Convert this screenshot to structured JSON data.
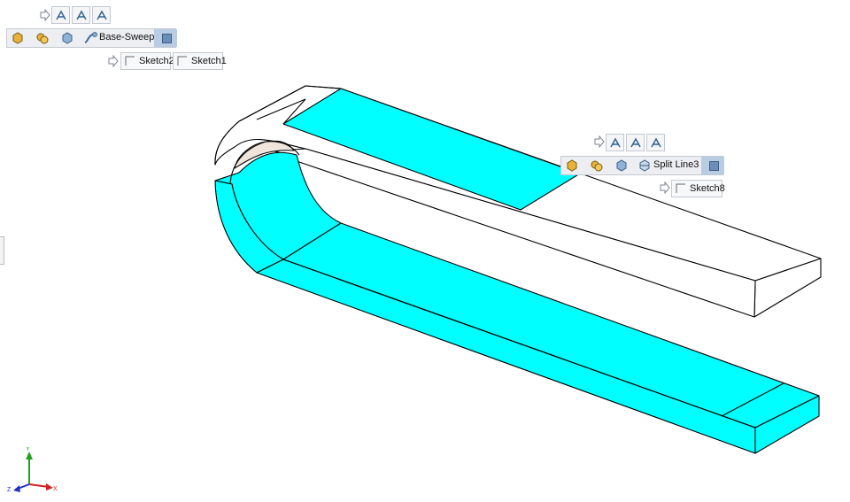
{
  "viewport": {
    "model": {
      "face_color": "#00FFFF",
      "edge_color": "#000000",
      "body_color": "#FFFFFF"
    }
  },
  "breadcrumb_top": {
    "feature_label": "Base-Sweep",
    "sketches": [
      "Sketch2",
      "Sketch1"
    ]
  },
  "breadcrumb_right": {
    "feature_label": "Split Line3",
    "sketches": [
      "Sketch8"
    ]
  },
  "triad": {
    "x_label": "X",
    "y_label": "Y",
    "z_label": "Z",
    "x_color": "#D02020",
    "y_color": "#20A020",
    "z_color": "#2030C0"
  },
  "icons": [
    "arrow-right-icon",
    "dimension-icon",
    "part-icon",
    "assembly-icon",
    "body-icon",
    "sweep-icon",
    "split-line-icon",
    "sketch-icon"
  ]
}
